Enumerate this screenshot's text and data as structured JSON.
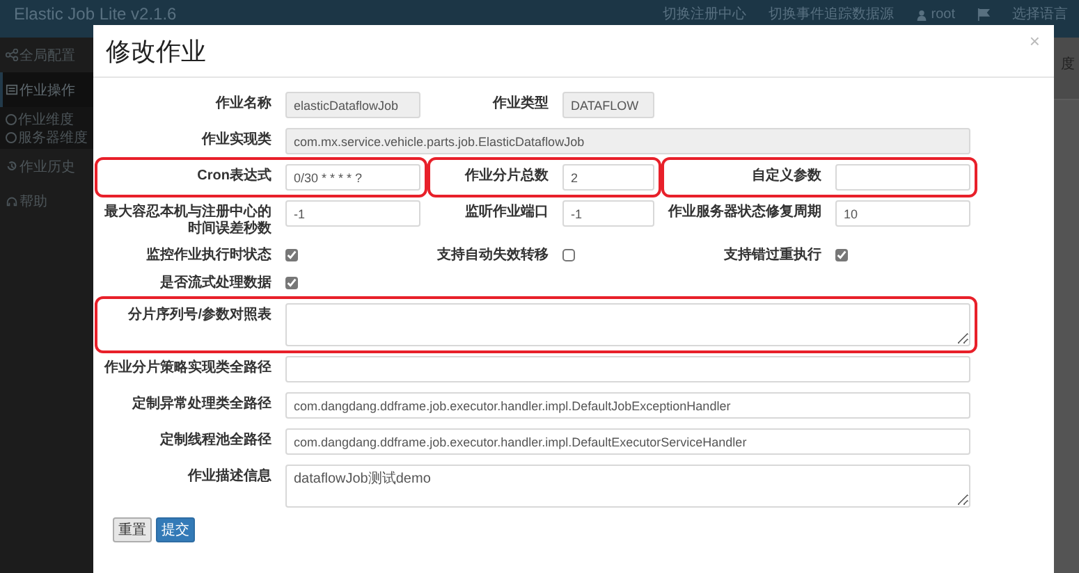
{
  "navbar": {
    "brand": "Elastic Job Lite v2.1.6",
    "links": [
      "切换注册中心",
      "切换事件追踪数据源"
    ],
    "user": "root",
    "language": "选择语言"
  },
  "sidebar": {
    "items": [
      {
        "label": "全局配置",
        "selected": false
      },
      {
        "label": "作业操作",
        "selected": true,
        "children": [
          {
            "label": "作业维度"
          },
          {
            "label": "服务器维度"
          }
        ]
      },
      {
        "label": "作业历史",
        "selected": false
      },
      {
        "label": "帮助",
        "selected": false
      }
    ]
  },
  "background": {
    "tab": "度"
  },
  "modal": {
    "title": "修改作业",
    "close": "×",
    "rows": [
      {
        "fields": [
          {
            "label": "作业名称",
            "kind": "text",
            "value": "elasticDataflowJob",
            "disabled": true
          },
          {
            "label": "作业类型",
            "kind": "text",
            "value": "DATAFLOW",
            "disabled": true
          }
        ]
      },
      {
        "fields": [
          {
            "label": "作业实现类",
            "kind": "wide-text",
            "value": "com.mx.service.vehicle.parts.job.ElasticDataflowJob",
            "disabled": true
          }
        ]
      },
      {
        "fields": [
          {
            "label": "Cron表达式",
            "kind": "text",
            "value": "0/30 * * * * ?",
            "disabled": false,
            "highlighted": true
          },
          {
            "label": "作业分片总数",
            "kind": "text",
            "value": "2",
            "disabled": false,
            "highlighted": true
          },
          {
            "label": "自定义参数",
            "kind": "text",
            "disabled": false,
            "highlighted": true
          }
        ]
      },
      {
        "fields": [
          {
            "label": "最大容忍本机与注册中心的时间误差秒数",
            "kind": "text",
            "value": "-1",
            "disabled": false
          },
          {
            "label": "监听作业端口",
            "kind": "text",
            "value": "-1",
            "disabled": false
          },
          {
            "label": "作业服务器状态修复周期",
            "kind": "text",
            "value": "10",
            "disabled": false
          }
        ]
      },
      {
        "fields": [
          {
            "label": "监控作业执行时状态",
            "kind": "checkbox",
            "checked": true
          },
          {
            "label": "支持自动失效转移",
            "kind": "checkbox",
            "checked": false
          },
          {
            "label": "支持错过重执行",
            "kind": "checkbox",
            "checked": true
          }
        ]
      },
      {
        "fields": [
          {
            "label": "是否流式处理数据",
            "kind": "checkbox",
            "checked": true
          }
        ]
      },
      {
        "fields": [
          {
            "label": "分片序列号/参数对照表",
            "kind": "textarea",
            "disabled": false,
            "highlighted": true
          }
        ]
      },
      {
        "fields": [
          {
            "label": "作业分片策略实现类全路径",
            "kind": "wide-text",
            "disabled": false
          }
        ]
      },
      {
        "fields": [
          {
            "label": "定制异常处理类全路径",
            "kind": "wide-text",
            "value": "com.dangdang.ddframe.job.executor.handler.impl.DefaultJobExceptionHandler",
            "disabled": false
          }
        ]
      },
      {
        "fields": [
          {
            "label": "定制线程池全路径",
            "kind": "wide-text",
            "value": "com.dangdang.ddframe.job.executor.handler.impl.DefaultExecutorServiceHandler",
            "disabled": false
          }
        ]
      },
      {
        "fields": [
          {
            "label": "作业描述信息",
            "kind": "textarea",
            "value": "dataflowJob测试demo",
            "disabled": false
          }
        ]
      }
    ],
    "buttons": [
      {
        "label": "重置",
        "kind": "default"
      },
      {
        "label": "提交",
        "kind": "primary"
      }
    ]
  }
}
